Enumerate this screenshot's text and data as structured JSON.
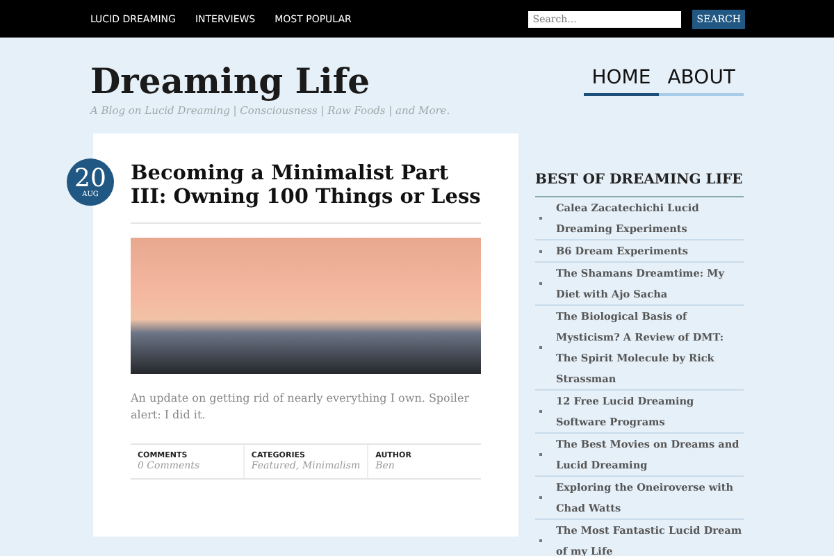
{
  "top_nav": {
    "links": [
      "LUCID DREAMING",
      "INTERVIEWS",
      "MOST POPULAR"
    ],
    "search": {
      "placeholder": "Search..."
    },
    "search_button": "SEARCH"
  },
  "header": {
    "site_title": "Dreaming Life",
    "tagline": "A Blog on Lucid Dreaming | Consciousness | Raw Foods | and More.",
    "menu": [
      {
        "label": "HOME",
        "selected": true
      },
      {
        "label": "ABOUT",
        "selected": false
      }
    ]
  },
  "post": {
    "date_day": "20",
    "date_month": "AUG",
    "title": "Becoming a Minimalist Part III: Owning 100 Things or Less",
    "excerpt": "An update on getting rid of nearly everything I own. Spoiler alert: I did it.",
    "meta": [
      {
        "label": "COMMENTS",
        "value": "0 Comments"
      },
      {
        "label": "CATEGORIES",
        "value": "Featured, Minimalism"
      },
      {
        "label": "AUTHOR",
        "value": "Ben"
      }
    ]
  },
  "sidebar": {
    "heading": "BEST OF DREAMING LIFE",
    "items": [
      "Calea Zacatechichi Lucid Dreaming Experiments",
      "B6 Dream Experiments",
      "The Shamans Dreamtime: My Diet with Ajo Sacha",
      "The Biological Basis of Mysticism? A Review of DMT: The Spirit Molecule by Rick Strassman",
      "12 Free Lucid Dreaming Software Programs",
      "The Best Movies on Dreams and Lucid Dreaming",
      "Exploring the Oneiroverse with Chad Watts",
      "The Most Fantastic Lucid Dream of my Life"
    ]
  }
}
